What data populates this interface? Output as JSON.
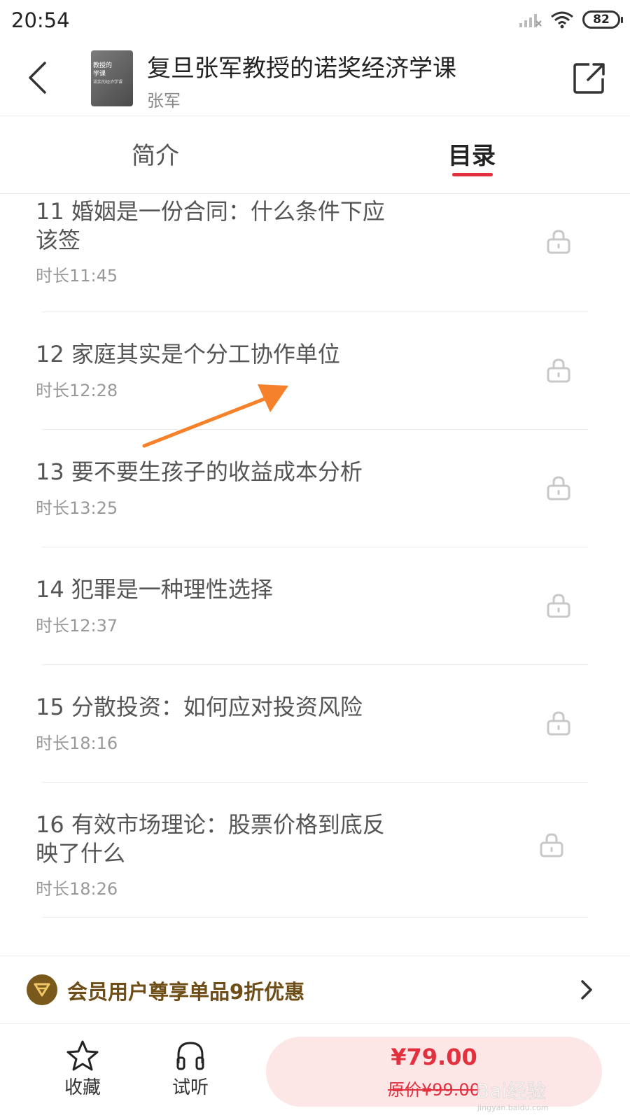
{
  "status_bar": {
    "time": "20:54",
    "battery": "82"
  },
  "header": {
    "cover_text_lines": [
      "教授的",
      "学课",
      "诺奖的经济学课"
    ],
    "title": "复旦张军教授的诺奖经济学课",
    "author": "张军"
  },
  "tabs": [
    {
      "label": "简介",
      "active": false
    },
    {
      "label": "目录",
      "active": true
    }
  ],
  "chapters": [
    {
      "title": "11 婚姻是一份合同：什么条件下应该签",
      "duration": "时长11:45",
      "locked": true
    },
    {
      "title": "12 家庭其实是个分工协作单位",
      "duration": "时长12:28",
      "locked": true
    },
    {
      "title": "13 要不要生孩子的收益成本分析",
      "duration": "时长13:25",
      "locked": true
    },
    {
      "title": "14 犯罪是一种理性选择",
      "duration": "时长12:37",
      "locked": true
    },
    {
      "title": "15 分散投资：如何应对投资风险",
      "duration": "时长18:16",
      "locked": true
    },
    {
      "title": "16 有效市场理论：股票价格到底反映了什么",
      "duration": "时长18:26",
      "locked": true
    }
  ],
  "member_banner": {
    "text": "会员用户尊享单品9折优惠"
  },
  "bottom_bar": {
    "favorite_label": "收藏",
    "listen_label": "试听",
    "price": "¥79.00",
    "original_price": "原价¥99.00"
  },
  "colors": {
    "accent": "#e2303e",
    "buy_bg": "#fde6e6",
    "member_text": "#6e4d16",
    "arrow": "#f5822a"
  },
  "icons": {
    "back": "back-arrow-icon",
    "share": "share-icon",
    "lock": "lock-icon",
    "star": "star-icon",
    "headphones": "headphones-icon",
    "vip": "vip-diamond-icon",
    "chevron": "chevron-right-icon"
  }
}
